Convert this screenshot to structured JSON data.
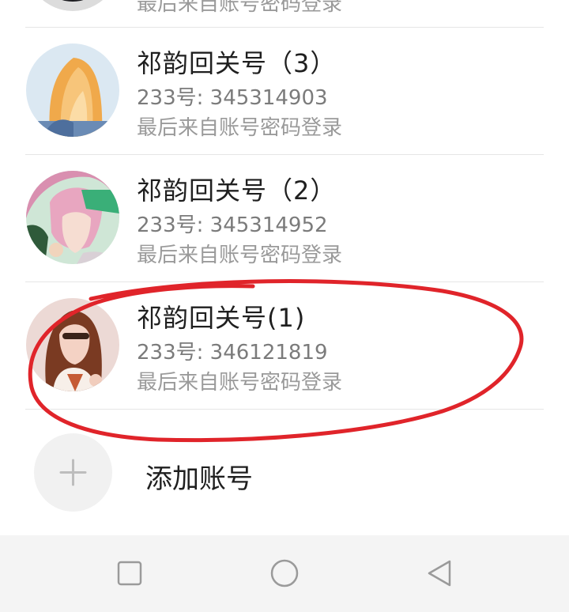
{
  "accounts": [
    {
      "name": "",
      "uid": "",
      "login_source": "最后来自账号密码登录",
      "avatar": "dark-avatar"
    },
    {
      "name": "祁韵回关号（3）",
      "uid": "233号: 345314903",
      "login_source": "最后来自账号密码登录",
      "avatar": "blonde-girl-avatar"
    },
    {
      "name": "祁韵回关号（2）",
      "uid": "233号: 345314952",
      "login_source": "最后来自账号密码登录",
      "avatar": "pink-hair-anime-avatar"
    },
    {
      "name": "祁韵回关号(1)",
      "uid": "233号: 346121819",
      "login_source": "最后来自账号密码登录",
      "avatar": "brown-hair-girl-avatar"
    }
  ],
  "add_account": {
    "label": "添加账号",
    "icon": "plus-icon"
  },
  "navigation": {
    "recent_icon": "square-icon",
    "home_icon": "circle-icon",
    "back_icon": "triangle-back-icon"
  },
  "annotation": {
    "color": "#e0242a",
    "target": "祁韵回关号(1)"
  }
}
